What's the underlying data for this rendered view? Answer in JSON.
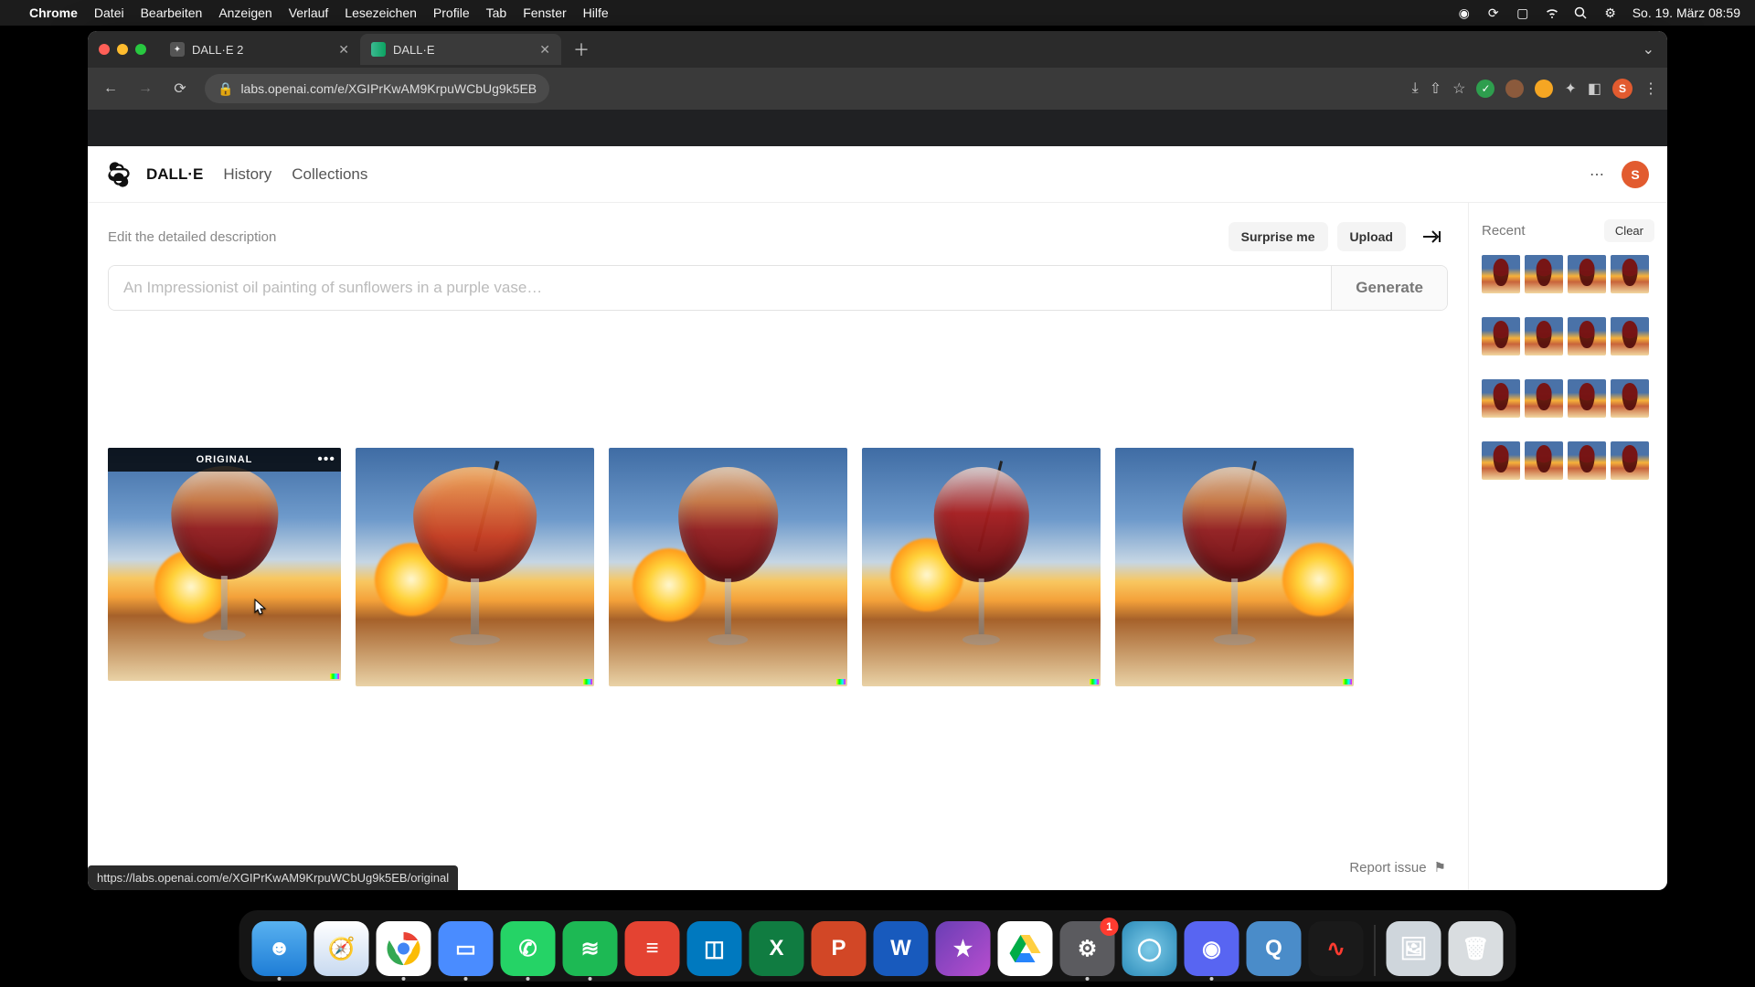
{
  "mac_menu": {
    "app": "Chrome",
    "items": [
      "Datei",
      "Bearbeiten",
      "Anzeigen",
      "Verlauf",
      "Lesezeichen",
      "Profile",
      "Tab",
      "Fenster",
      "Hilfe"
    ],
    "clock": "So. 19. März  08:59"
  },
  "browser": {
    "tabs": [
      {
        "title": "DALL·E 2"
      },
      {
        "title": "DALL·E"
      }
    ],
    "url": "labs.openai.com/e/XGIPrKwAM9KrpuWCbUg9k5EB",
    "avatar_letter": "S"
  },
  "header": {
    "brand": "DALL·E",
    "links": [
      "History",
      "Collections"
    ],
    "avatar_letter": "S"
  },
  "main": {
    "edit_label": "Edit the detailed description",
    "surprise": "Surprise me",
    "upload": "Upload",
    "prompt_placeholder": "An Impressionist oil painting of sunflowers in a purple vase…",
    "generate": "Generate",
    "original_badge": "ORIGINAL",
    "report_issue": "Report issue"
  },
  "sidebar": {
    "title": "Recent",
    "clear": "Clear",
    "rows": 4,
    "cols": 4
  },
  "status_url": "https://labs.openai.com/e/XGIPrKwAM9KrpuWCbUg9k5EB/original",
  "dock": {
    "settings_badge": "1"
  }
}
